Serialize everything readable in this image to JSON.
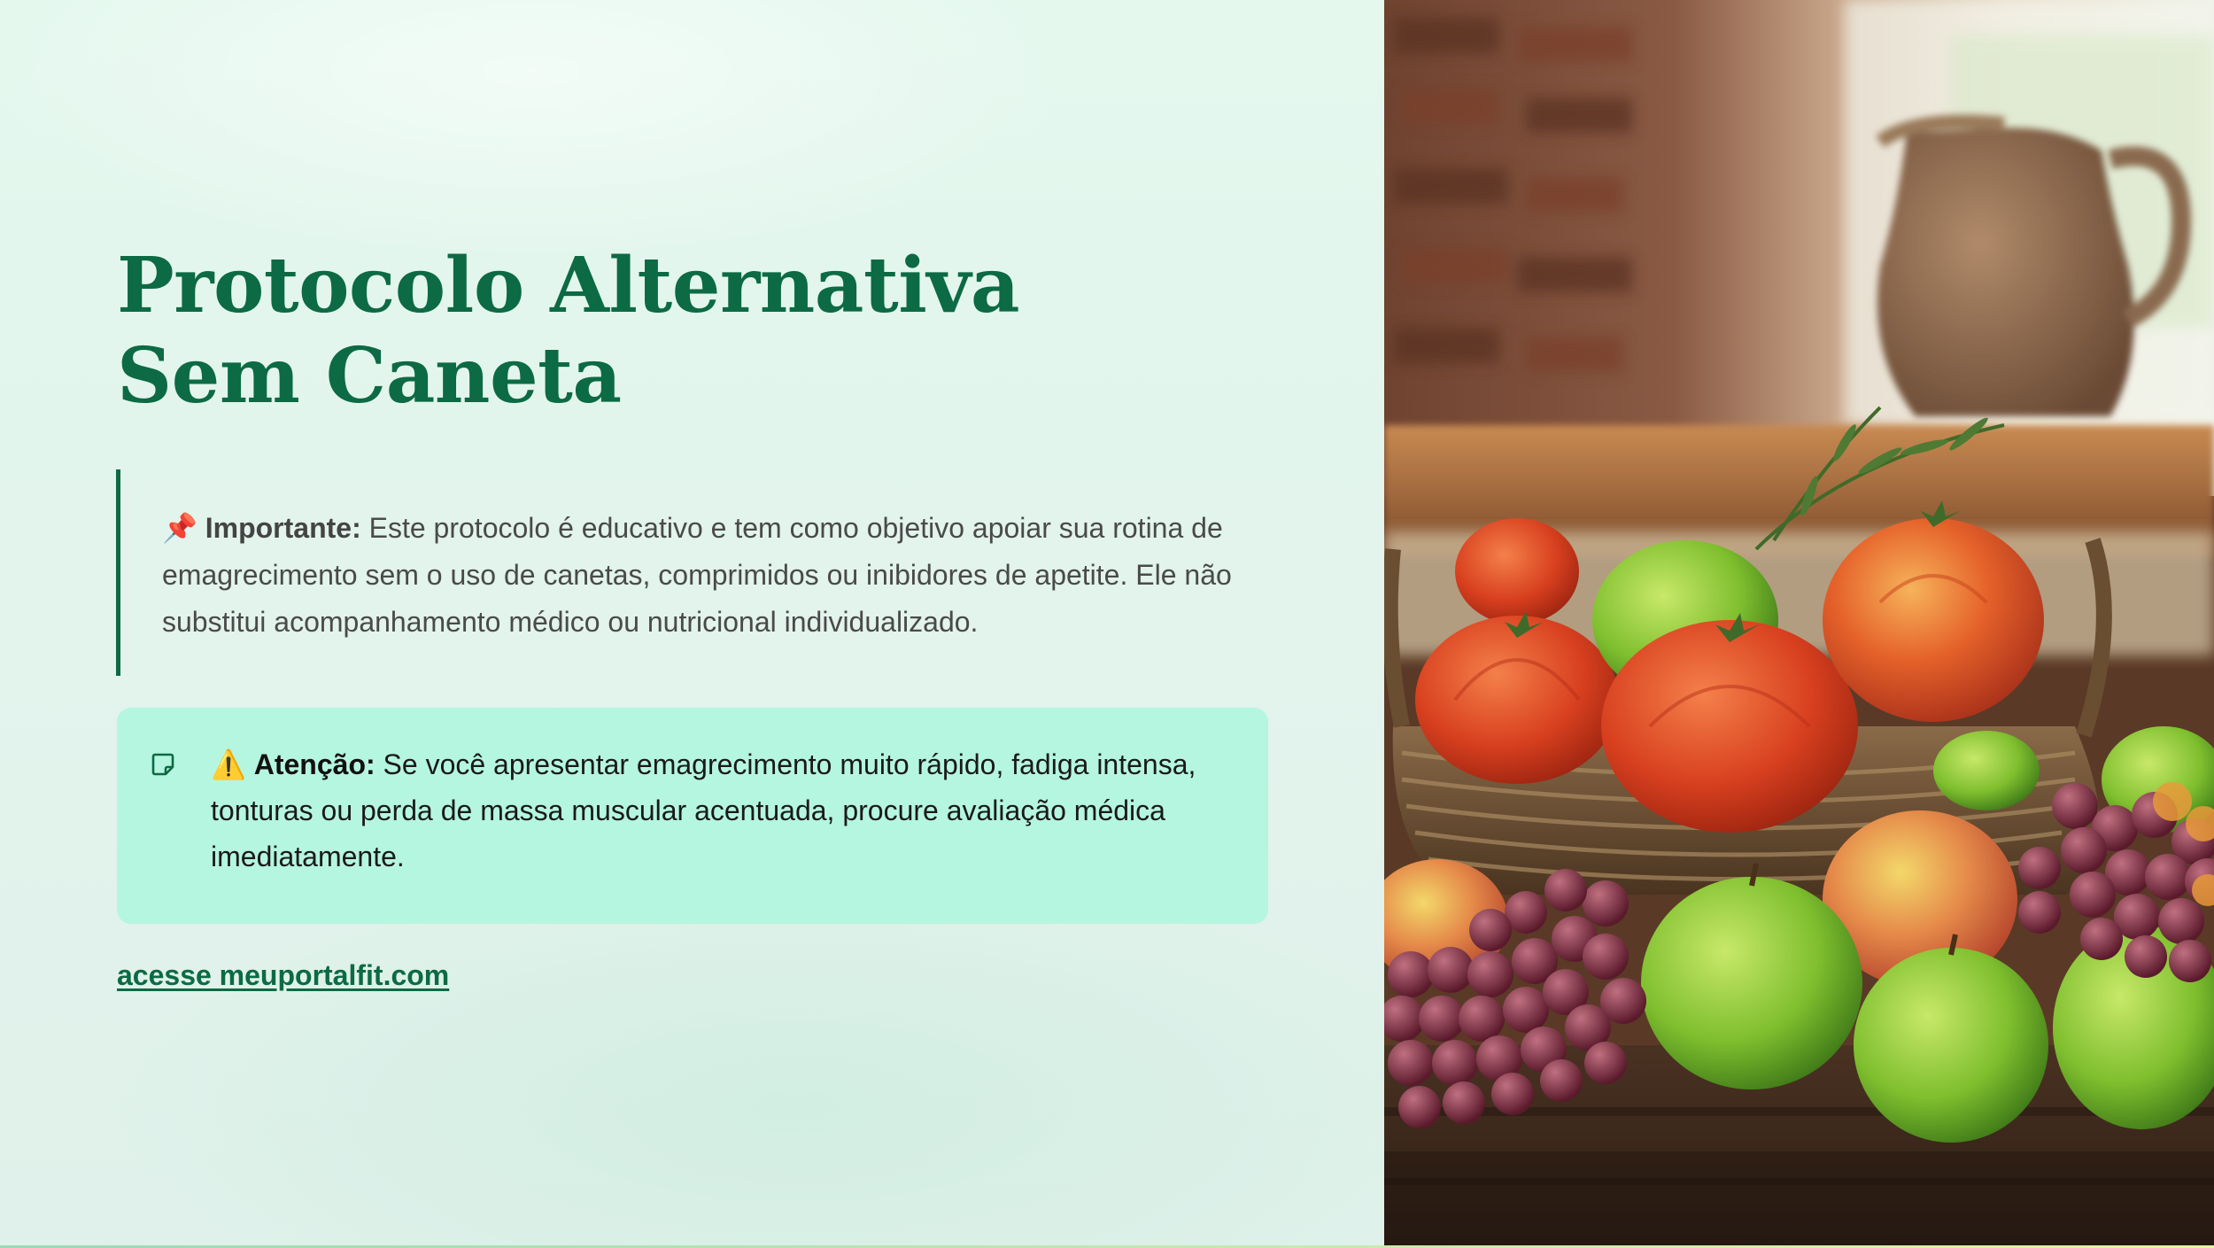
{
  "slide": {
    "title": "Protocolo Alternativa Sem Caneta",
    "important": {
      "icon": "pushpin-icon",
      "emoji": "📌",
      "label": "Importante:",
      "text": "Este protocolo é educativo e tem como objetivo apoiar sua rotina de emagrecimento sem o uso de canetas, comprimidos ou inibidores de apetite. Ele não substitui acompanhamento médico ou nutricional individualizado."
    },
    "attention": {
      "box_icon": "note-icon",
      "warning_icon": "warning-icon",
      "emoji": "⚠️",
      "label": "Atenção:",
      "text": "Se você apresentar emagrecimento muito rápido, fadiga intensa, tonturas ou perda de massa muscular acentuada, procure avaliação médica imediatamente."
    },
    "cta_link": "acesse meuportalfit.com"
  },
  "colors": {
    "title_green": "#0c6a44",
    "panel_bg": "#e4f8ee",
    "attention_bg": "#b5f6e0",
    "body_text": "#4a4a4a"
  }
}
